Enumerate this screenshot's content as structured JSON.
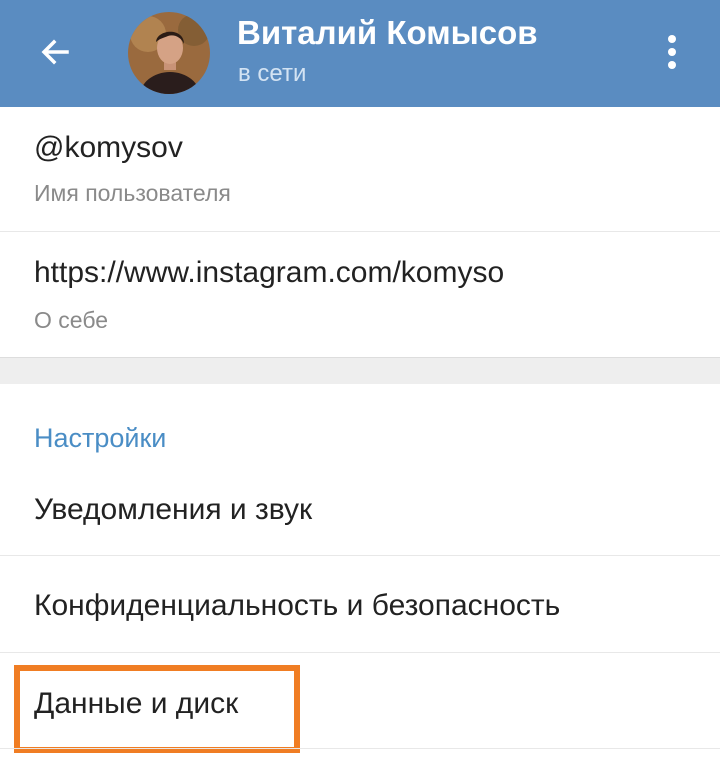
{
  "header": {
    "back_icon": "arrow-left-icon",
    "title": "Виталий Комысов",
    "status": "в сети",
    "menu_icon": "more-vertical-icon",
    "background_color": "#5a8cc1"
  },
  "profile": {
    "username": {
      "value": "@komysov",
      "label": "Имя пользователя"
    },
    "bio": {
      "value": "https://www.instagram.com/komyso",
      "label": "О себе"
    }
  },
  "settings": {
    "section_title": "Настройки",
    "accent_color": "#4a8dc5",
    "items": [
      {
        "label": "Уведомления и звук"
      },
      {
        "label": "Конфиденциальность и безопасность"
      },
      {
        "label": "Данные и диск",
        "highlighted": true
      }
    ],
    "highlight_color": "#f07d23"
  }
}
